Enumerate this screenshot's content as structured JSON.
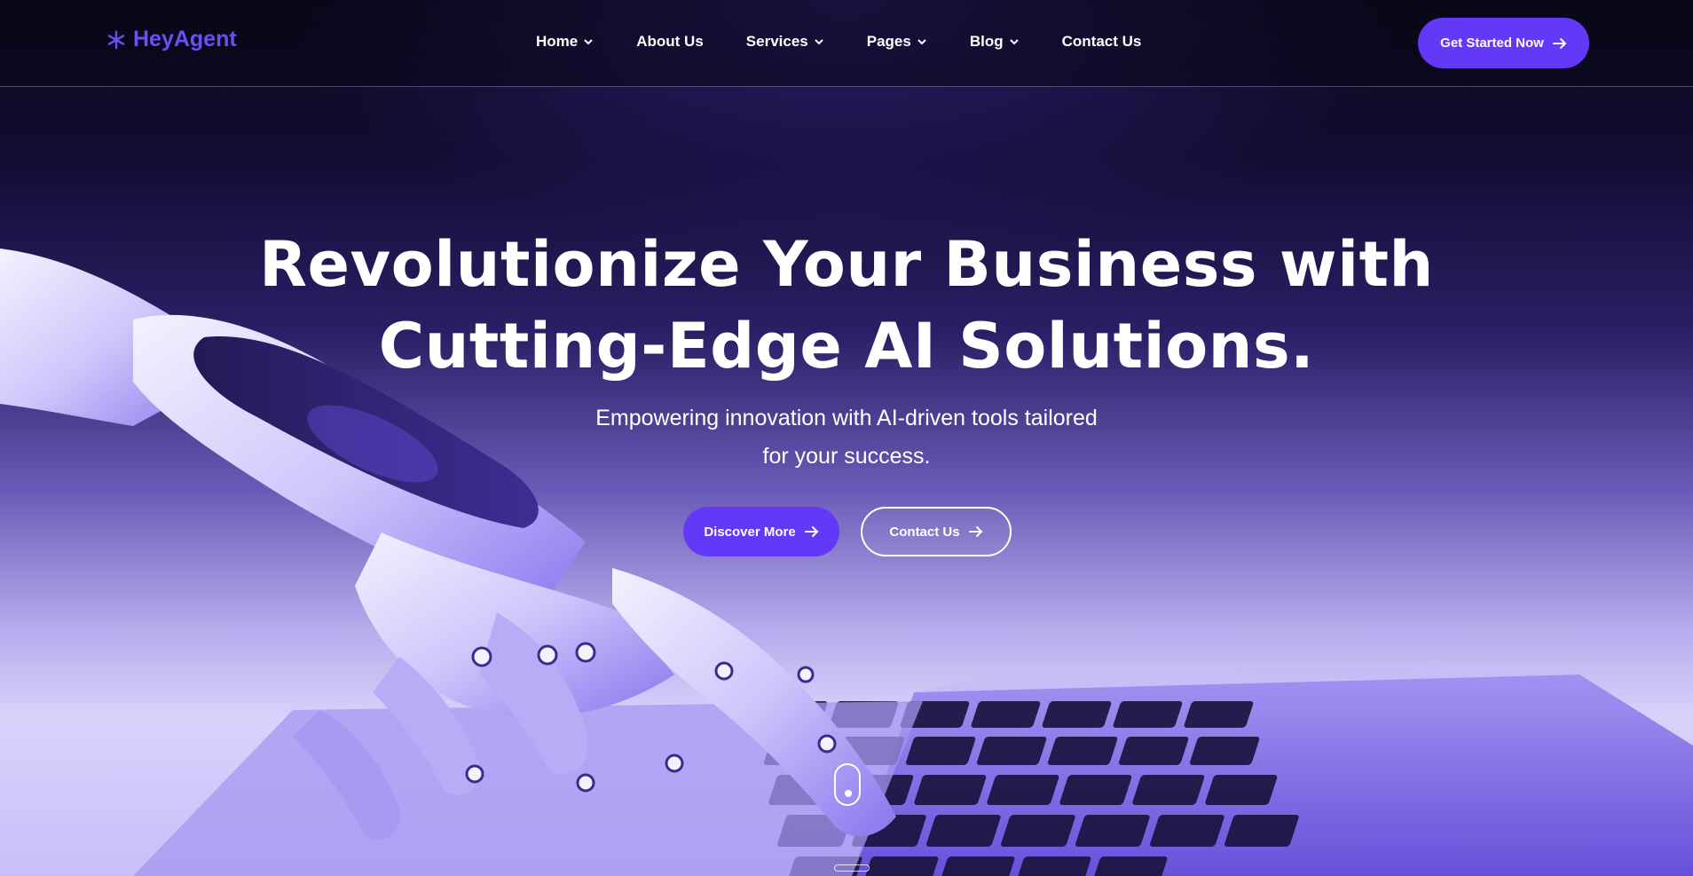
{
  "brand": {
    "name": "HeyAgent",
    "icon": "asterisk-icon",
    "color": "#6c4ef6"
  },
  "nav": {
    "items": [
      {
        "label": "Home",
        "has_dropdown": true
      },
      {
        "label": "About Us",
        "has_dropdown": false
      },
      {
        "label": "Services",
        "has_dropdown": true
      },
      {
        "label": "Pages",
        "has_dropdown": true
      },
      {
        "label": "Blog",
        "has_dropdown": true
      },
      {
        "label": "Contact Us",
        "has_dropdown": false
      }
    ]
  },
  "header": {
    "cta_label": "Get Started Now",
    "cta_icon": "arrow-right-icon"
  },
  "hero": {
    "headline_line1": "Revolutionize Your Business with",
    "headline_line2": "Cutting-Edge AI Solutions.",
    "subtitle_line1": "Empowering innovation with AI-driven tools tailored",
    "subtitle_line2": "for your success.",
    "primary_button": "Discover More",
    "secondary_button": "Contact Us",
    "background_image": "robot-hand-typing-on-laptop"
  },
  "colors": {
    "accent": "#6338f6",
    "text": "#ffffff",
    "dark_background": "#0d0b1f"
  }
}
